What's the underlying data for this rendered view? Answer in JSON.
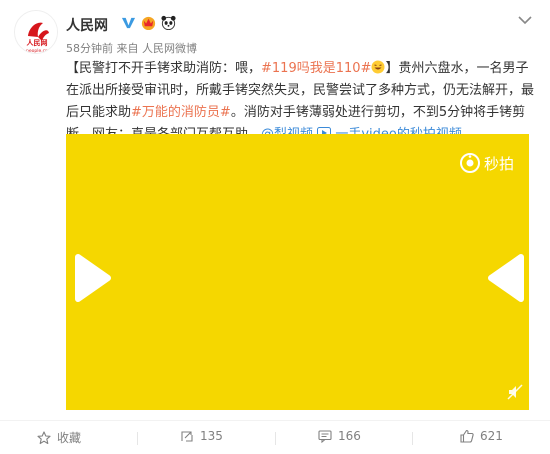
{
  "post": {
    "author": "人民网",
    "time": "58分钟前",
    "source_prefix": "来自",
    "source": "人民网微博",
    "text": {
      "p1": "【民警打不开手铐求助消防：喂，",
      "topic1": "#119吗我是110#",
      "p2": "】贵州六盘水，一名男子在派出所接受审讯时，所戴手铐突然失灵，民警尝试了多种方式，仍无法解开，最后只能求助",
      "topic2": "#万能的消防员#",
      "p3": "。消防对手铐薄弱处进行剪切，不到5分钟将手铐剪断。网友：真是各部门互帮互助。",
      "mention": "@梨视频",
      "link_label": "一手video的秒拍视频"
    },
    "avatar_text": "人民网",
    "avatar_sub": "people.cn"
  },
  "video": {
    "logo_text": "秒拍",
    "background": "#f5d700"
  },
  "actions": {
    "favorite_label": "收藏",
    "forward_count": "135",
    "comment_count": "166",
    "like_count": "621"
  },
  "colors": {
    "topic": "#eb7350",
    "link": "#3b8ad8",
    "meta": "#808080"
  },
  "icons": [
    "chevron-down-icon",
    "verified-icon",
    "crown-badge-icon",
    "panda-badge-icon",
    "play-icon",
    "mute-icon",
    "star-icon",
    "forward-icon",
    "comment-icon",
    "like-icon",
    "miaopai-logo-icon"
  ]
}
